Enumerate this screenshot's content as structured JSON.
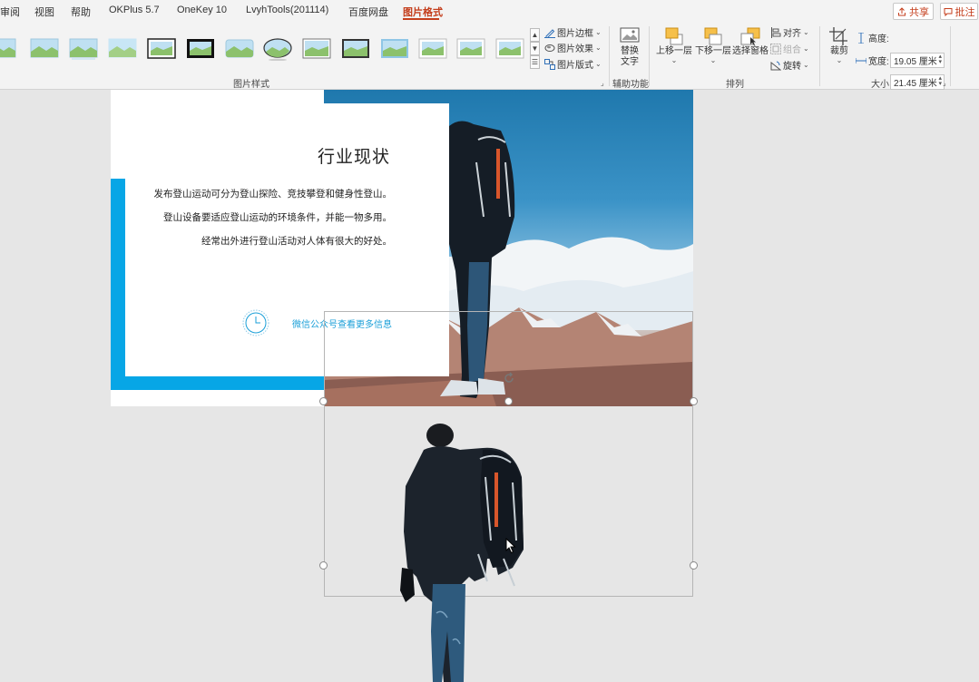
{
  "tabs": [
    "审阅",
    "视图",
    "帮助",
    "OKPlus 5.7",
    "OneKey 10",
    "LvyhTools(201114)",
    "百度网盘",
    "图片格式"
  ],
  "header_buttons": {
    "share": "共享",
    "comment": "批注"
  },
  "ribbon": {
    "picture_styles": {
      "label": "图片样式",
      "border": "图片边框",
      "effects": "图片效果",
      "layout": "图片版式"
    },
    "accessibility": {
      "label": "辅助功能",
      "alt_text_line1": "替换",
      "alt_text_line2": "文字"
    },
    "arrange": {
      "label": "排列",
      "bring_forward": "上移一层",
      "send_backward": "下移一层",
      "selection_pane": "选择窗格",
      "align": "对齐",
      "group": "组合",
      "rotate": "旋转"
    },
    "size": {
      "label": "大小",
      "crop": "裁剪",
      "height_label": "高度:",
      "height_value": "19.05 厘米",
      "width_label": "宽度:",
      "width_value": "21.45 厘米"
    }
  },
  "slide": {
    "title": "行业现状",
    "lines": [
      "发布登山运动可分为登山探险、竞技攀登和健身性登山。",
      "登山设备要适应登山运动的环境条件，并能一物多用。",
      "经常出外进行登山活动对人体有很大的好处。"
    ],
    "link": "微信公众号查看更多信息"
  },
  "colors": {
    "accent": "#c43e1c",
    "slide_blue": "#07a6e6",
    "link_blue": "#1a9fd8"
  }
}
